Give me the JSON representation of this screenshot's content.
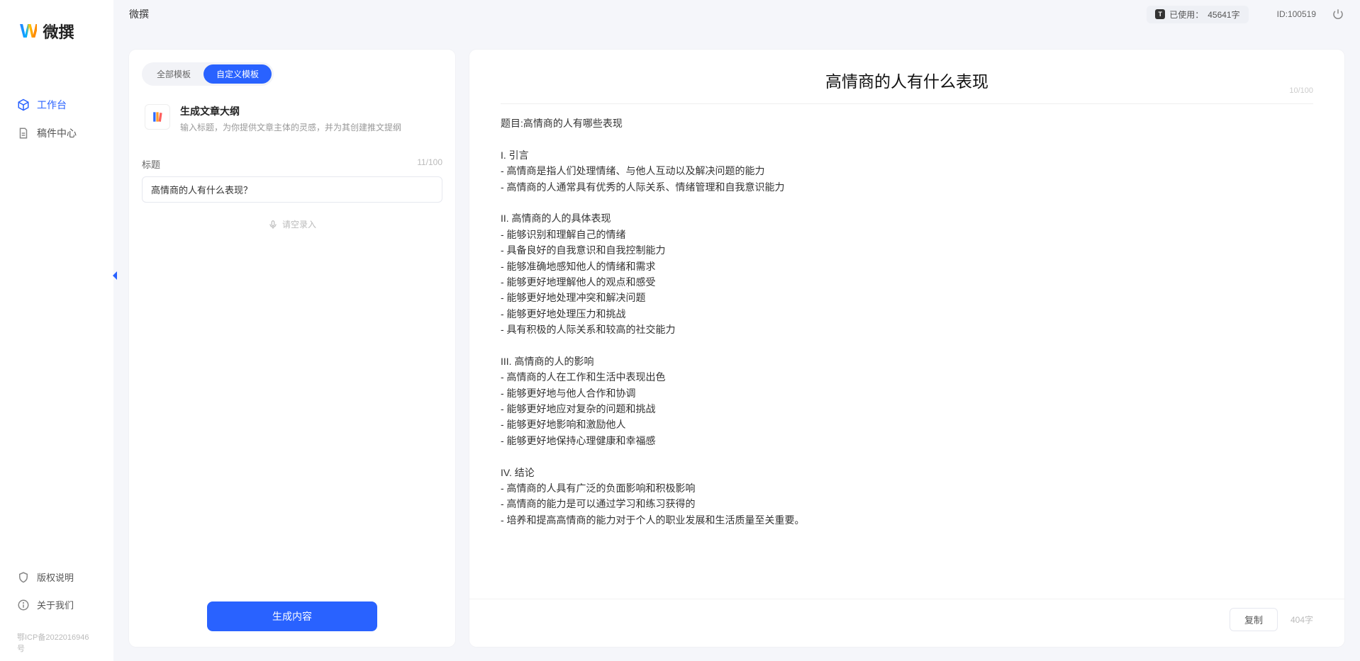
{
  "app": {
    "name": "微撰",
    "logo_mark": "W"
  },
  "sidebar": {
    "items": [
      {
        "label": "工作台",
        "icon": "cube",
        "active": true
      },
      {
        "label": "稿件中心",
        "icon": "doc",
        "active": false
      }
    ],
    "bottom": [
      {
        "label": "版权说明",
        "icon": "shield"
      },
      {
        "label": "关于我们",
        "icon": "info"
      }
    ],
    "icp": "鄂ICP备2022016946号"
  },
  "topbar": {
    "title": "微撰",
    "usage_prefix": "已使用：",
    "usage_value": "45641字",
    "id_label": "ID:100519"
  },
  "left": {
    "tabs": [
      {
        "label": "全部模板",
        "active": false
      },
      {
        "label": "自定义模板",
        "active": true
      }
    ],
    "template": {
      "title": "生成文章大纲",
      "desc": "输入标题，为你提供文章主体的灵感，并为其创建推文提纲"
    },
    "field_label": "标题",
    "field_counter": "11/100",
    "field_value": "高情商的人有什么表现？",
    "voice_hint": "请空录入",
    "generate_label": "生成内容"
  },
  "output": {
    "title": "高情商的人有什么表现",
    "title_counter": "10/100",
    "body": "题目:高情商的人有哪些表现\n\nI. 引言\n- 高情商是指人们处理情绪、与他人互动以及解决问题的能力\n- 高情商的人通常具有优秀的人际关系、情绪管理和自我意识能力\n\nII. 高情商的人的具体表现\n- 能够识别和理解自己的情绪\n- 具备良好的自我意识和自我控制能力\n- 能够准确地感知他人的情绪和需求\n- 能够更好地理解他人的观点和感受\n- 能够更好地处理冲突和解决问题\n- 能够更好地处理压力和挑战\n- 具有积极的人际关系和较高的社交能力\n\nIII. 高情商的人的影响\n- 高情商的人在工作和生活中表现出色\n- 能够更好地与他人合作和协调\n- 能够更好地应对复杂的问题和挑战\n- 能够更好地影响和激励他人\n- 能够更好地保持心理健康和幸福感\n\nIV. 结论\n- 高情商的人具有广泛的负面影响和积极影响\n- 高情商的能力是可以通过学习和练习获得的\n- 培养和提高高情商的能力对于个人的职业发展和生活质量至关重要。",
    "copy_label": "复制",
    "word_count": "404字"
  }
}
